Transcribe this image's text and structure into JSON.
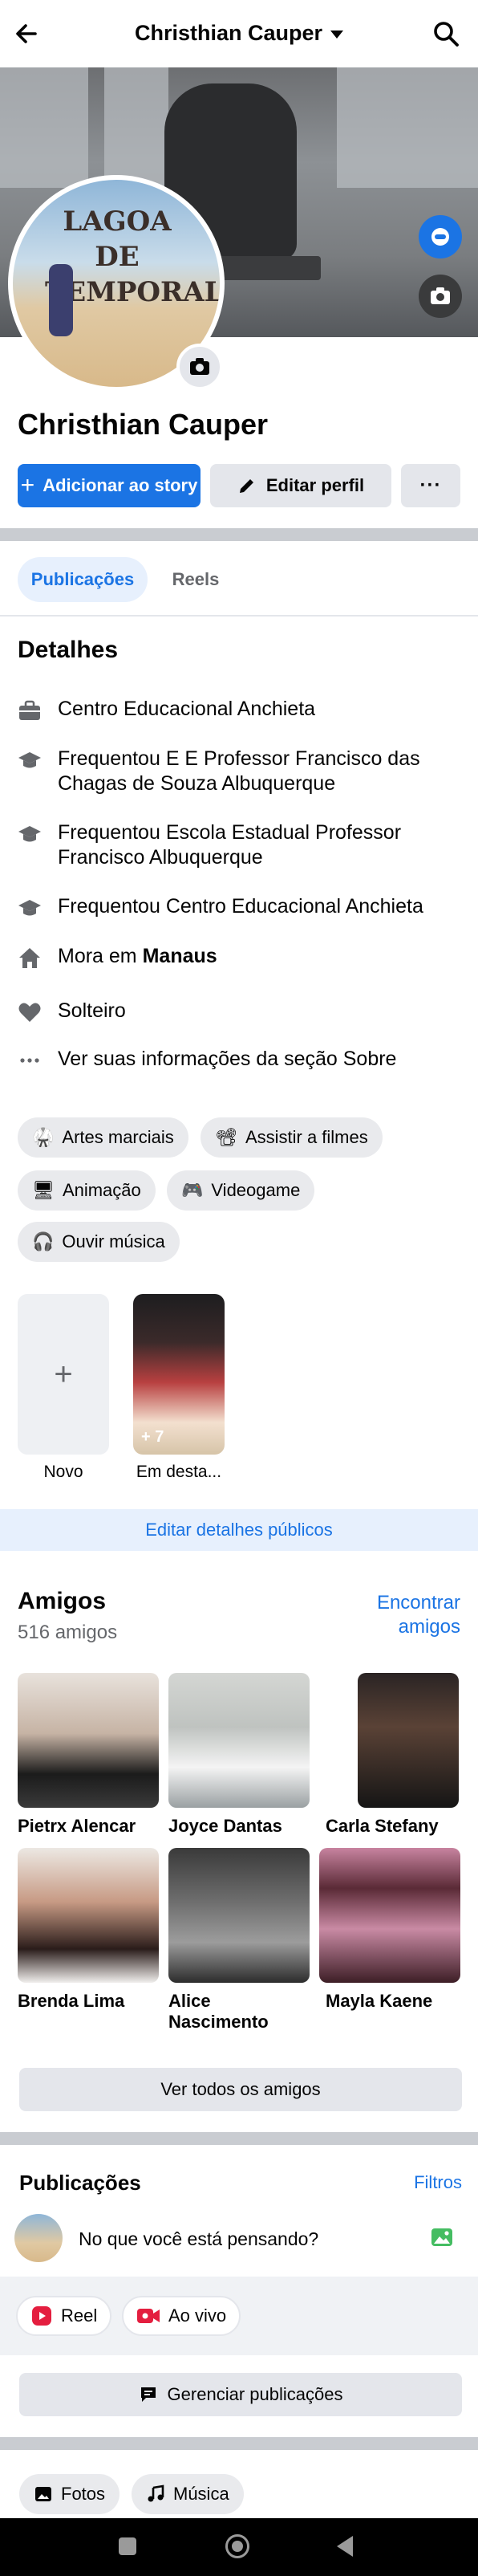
{
  "topbar": {
    "title": "Christhian Cauper",
    "back_icon": "arrow-left-icon",
    "search_icon": "search-icon"
  },
  "profile": {
    "name": "Christhian Cauper",
    "avatar_sign": "LAGOA DE TEMPORAL",
    "add_story_label": "Adicionar ao story",
    "edit_profile_label": "Editar perfil",
    "more_label": "···"
  },
  "tabs": [
    {
      "label": "Publicações",
      "active": true
    },
    {
      "label": "Reels",
      "active": false
    }
  ],
  "details": {
    "title": "Detalhes",
    "items": [
      {
        "icon": "briefcase-icon",
        "text": "Centro Educacional Anchieta"
      },
      {
        "icon": "graduation-cap-icon",
        "text": "Frequentou E E Professor Francisco das Chagas de Souza Albuquerque"
      },
      {
        "icon": "graduation-cap-icon",
        "text": "Frequentou Escola Estadual Professor Francisco Albuquerque"
      },
      {
        "icon": "graduation-cap-icon",
        "text": "Frequentou Centro Educacional Anchieta"
      },
      {
        "icon": "home-icon",
        "prefix": "Mora em ",
        "bold": "Manaus"
      },
      {
        "icon": "heart-icon",
        "text": "Solteiro"
      },
      {
        "icon": "more-dots-icon",
        "text": "Ver suas informações da seção Sobre"
      }
    ]
  },
  "interests": [
    {
      "emoji": "🥋",
      "label": "Artes marciais"
    },
    {
      "emoji": "📽",
      "label": "Assistir a filmes"
    },
    {
      "emoji": "🖥",
      "label": "Animação"
    },
    {
      "emoji": "🎮",
      "label": "Videogame"
    },
    {
      "emoji": "🎧",
      "label": "Ouvir música"
    }
  ],
  "highlights": {
    "new_label": "Novo",
    "featured_label": "Em desta...",
    "featured_count": "+ 7"
  },
  "edit_public_label": "Editar detalhes públicos",
  "friends": {
    "title": "Amigos",
    "count": "516 amigos",
    "find_label": "Encontrar amigos",
    "list": [
      {
        "name": "Pietrx Alencar",
        "bg": "linear-gradient(180deg,#e8e2dc 0%,#c6b3a4 45%,#1b1b1b 75%,#3a3a3a 100%)"
      },
      {
        "name": "Joyce Dantas",
        "bg": "linear-gradient(180deg,#d4d6d3 0%,#bfc3c0 40%,#f4f4f4 70%,#9aa0a2 100%)"
      },
      {
        "name": "Carla Stefany",
        "bg": "linear-gradient(180deg,#2a2424 0%,#5a4236 40%,#151515 100%)"
      },
      {
        "name": "Brenda Lima",
        "bg": "linear-gradient(180deg,#ece8e3 0%,#c79a84 40%,#2a1c1a 75%,#f1efed 100%)"
      },
      {
        "name": "Alice Nascimento",
        "bg": "linear-gradient(180deg,#3a3a3a 0%,#6e6e6e 40%,#9c9c9c 70%,#2c2c2c 100%)"
      },
      {
        "name": "Mayla Kaene",
        "bg": "linear-gradient(180deg,#c7839f 0%,#5a2a36 30%,#c98aa4 60%,#3d1e26 100%)"
      }
    ],
    "see_all_label": "Ver todos os amigos"
  },
  "posts": {
    "title": "Publicações",
    "filters_label": "Filtros",
    "composer_placeholder": "No que você está pensando?",
    "reel_label": "Reel",
    "live_label": "Ao vivo",
    "manage_label": "Gerenciar publicações"
  },
  "media_tabs": [
    {
      "label": "Fotos"
    },
    {
      "label": "Música"
    }
  ],
  "colors": {
    "accent": "#1b74e4",
    "separator": "#c9ccd1",
    "chip_bg": "#e9eaed"
  }
}
